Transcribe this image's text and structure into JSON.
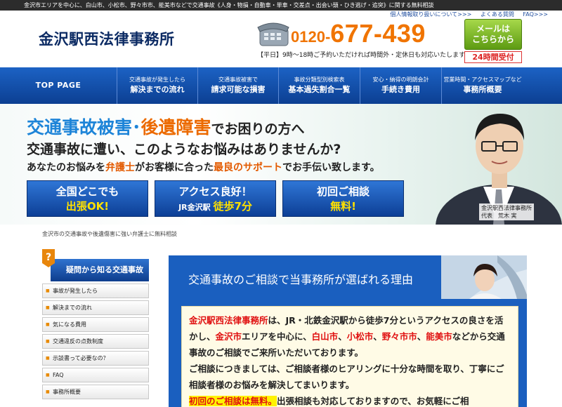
{
  "topbar": {
    "text": "金沢市エリアを中心に、白山市、小松市、野々市市、能美市などで交通事故《人身・物損・自動車・単車・交差点・出会い頭・ひき逃げ・追突》に関する無料相談"
  },
  "header": {
    "logo": "金沢駅西法律事務所",
    "links": [
      "個人情報取り扱いについて>>>",
      "よくある質問",
      "FAQ>>>"
    ],
    "phone_prefix": "0120-",
    "phone_main": "677-439",
    "hours": "【平日】9時～18時ご予約いただければ時間外・定休日も対応いたします",
    "mail_line1": "メールは",
    "mail_line2": "こちらから",
    "badge_24h": "24時間受付"
  },
  "nav": [
    {
      "small": "",
      "big": "TOP PAGE"
    },
    {
      "small": "交通事故が発生したら",
      "big": "解決までの流れ"
    },
    {
      "small": "交通事故被害で",
      "big": "請求可能な損害"
    },
    {
      "small": "事故分類型別検索表",
      "big": "基本過失割合一覧"
    },
    {
      "small": "安心・納得の明朗会計",
      "big": "手続き費用"
    },
    {
      "small": "営業時間・アクセスマップなど",
      "big": "事務所概要"
    }
  ],
  "hero": {
    "l1_a": "交通事故被害",
    "l1_dot": "･",
    "l1_b": "後遺障害",
    "l1_c": "でお困りの方へ",
    "l2": "交通事故に遭い、このようなお悩みはありませんか?",
    "l3_a": "あなたのお悩みを",
    "l3_b": "弁護士",
    "l3_c": "がお客様に合った",
    "l3_d": "最良のサポート",
    "l3_e": "でお手伝い致します。",
    "buttons": [
      {
        "a": "全国どこでも",
        "b": "出張OK!",
        "b_pre": ""
      },
      {
        "a": "アクセス良好！",
        "b": "徒歩7分",
        "b_pre": "JR金沢駅 "
      },
      {
        "a": "初回ご相談",
        "b": "無料!",
        "b_pre": ""
      }
    ],
    "caption1": "金沢駅西法律事務所",
    "caption2": "代表　荒木 実"
  },
  "breadcrumb": "金沢市の交通事故や後遺傷害に強い弁護士に無料相談",
  "sidebar": {
    "heading": "疑問から知る交通事故",
    "items": [
      "事故が発生したら",
      "解決までの流れ",
      "気になる費用",
      "交通違反の点数制度",
      "示談書って必要なの？",
      "FAQ",
      "事務所概要"
    ]
  },
  "main": {
    "title": "交通事故のご相談で当事務所が選ばれる理由",
    "p1_a": "金沢駅西法律事務所",
    "p1_b": "は、JR・北鉄金沢駅から徒歩7分というアクセスの良さを活かし、",
    "p1_c": "金沢市",
    "p1_d": "エリアを中心に、",
    "p1_e": "白山市",
    "p1_f": "、",
    "p1_g": "小松市",
    "p1_h": "、",
    "p1_i": "野々市市",
    "p1_j": "、",
    "p1_k": "能美市",
    "p1_l": "などから交通事故のご相談でご来所いただいております。",
    "p2": "ご相談につきましては、ご相談者様のヒアリングに十分な時間を取り、丁寧にご相談者様のお悩みを解決してまいります。",
    "p3_a": "初回のご相談は無料。",
    "p3_b": "出張相談も対応しておりますので、お気軽にご相"
  }
}
